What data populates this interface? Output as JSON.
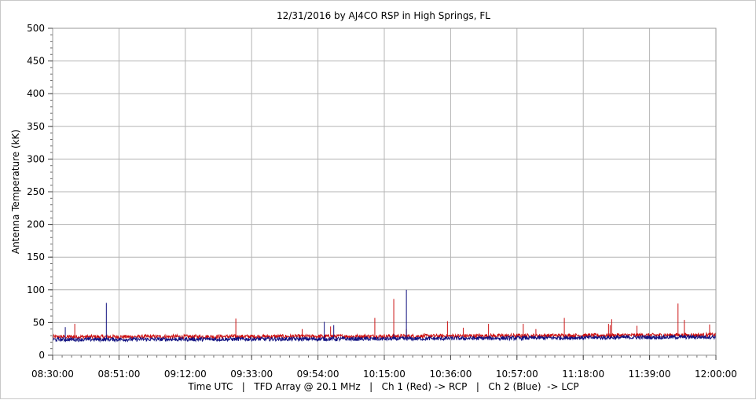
{
  "chart_data": {
    "type": "line",
    "title": "12/31/2016  by  AJ4CO RSP  in  High Springs, FL",
    "ylabel": "Antenna Temperature (kK)",
    "xlabel": "Time UTC   |   TFD Array @ 20.1 MHz   |   Ch 1 (Red) -> RCP   |   Ch 2 (Blue)  -> LCP",
    "ylim": [
      0,
      500
    ],
    "yticks": [
      "0",
      "50",
      "100",
      "150",
      "200",
      "250",
      "300",
      "350",
      "400",
      "450",
      "500"
    ],
    "xticks": [
      "08:30:00",
      "08:51:00",
      "09:12:00",
      "09:33:00",
      "09:54:00",
      "10:15:00",
      "10:36:00",
      "10:57:00",
      "11:18:00",
      "11:39:00",
      "12:00:00"
    ],
    "xlim_minutes": [
      0,
      210
    ],
    "grid": true,
    "series": [
      {
        "name": "Ch 1 (Red) -> RCP",
        "color": "#cc1111",
        "baseline": [
          [
            0,
            28
          ],
          [
            105,
            29
          ],
          [
            210,
            31
          ]
        ],
        "noise": 3,
        "spikes": [
          [
            7,
            48
          ],
          [
            58,
            56
          ],
          [
            79,
            40
          ],
          [
            88,
            44
          ],
          [
            102,
            57
          ],
          [
            112,
            40
          ],
          [
            125,
            52
          ],
          [
            108,
            86
          ],
          [
            130,
            42
          ],
          [
            138,
            48
          ],
          [
            149,
            48
          ],
          [
            153,
            40
          ],
          [
            162,
            57
          ],
          [
            176,
            48
          ],
          [
            177,
            55
          ],
          [
            185,
            45
          ],
          [
            176.5,
            46
          ],
          [
            198,
            79
          ],
          [
            200,
            54
          ],
          [
            208,
            47
          ],
          [
            211,
            62
          ]
        ]
      },
      {
        "name": "Ch 2 (Blue)  -> LCP",
        "color": "#101080",
        "baseline": [
          [
            0,
            24
          ],
          [
            105,
            25
          ],
          [
            210,
            28
          ]
        ],
        "noise": 3,
        "spikes": [
          [
            4,
            43
          ],
          [
            17,
            80
          ],
          [
            86,
            51
          ],
          [
            89,
            46
          ],
          [
            112,
            100
          ],
          [
            108,
            32
          ]
        ]
      }
    ]
  }
}
